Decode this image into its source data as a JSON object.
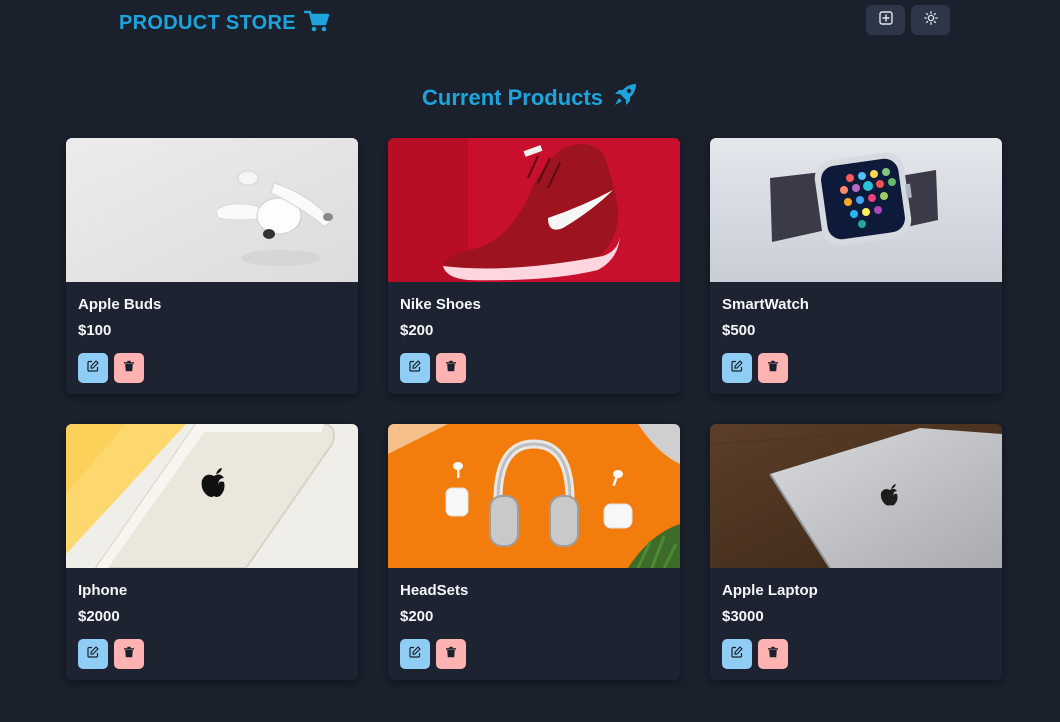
{
  "navbar": {
    "brand": "PRODUCT STORE",
    "brand_icon": "shopping-cart-icon",
    "create_icon": "plus-square-icon",
    "theme_icon": "sun-icon"
  },
  "main": {
    "title": "Current Products",
    "title_icon": "rocket-icon"
  },
  "products": [
    {
      "name": "Apple Buds",
      "price": "$100",
      "image": "airpods-photo"
    },
    {
      "name": "Nike Shoes",
      "price": "$200",
      "image": "nike-shoe-photo"
    },
    {
      "name": "SmartWatch",
      "price": "$500",
      "image": "smartwatch-photo"
    },
    {
      "name": "Iphone",
      "price": "$2000",
      "image": "iphone-photo"
    },
    {
      "name": "HeadSets",
      "price": "$200",
      "image": "headphones-photo"
    },
    {
      "name": "Apple Laptop",
      "price": "$3000",
      "image": "laptop-photo"
    }
  ],
  "colors": {
    "background": "#1a202c",
    "accent": "#1ea4dc",
    "edit_button": "#90cdf4",
    "delete_button": "#feb2b2"
  }
}
